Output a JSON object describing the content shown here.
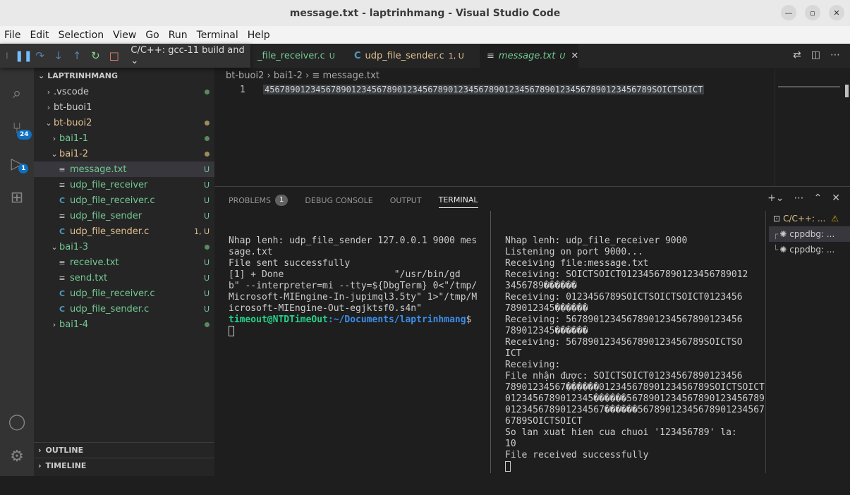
{
  "window": {
    "title": "message.txt - laptrinhmang - Visual Studio Code"
  },
  "menu": [
    "File",
    "Edit",
    "Selection",
    "View",
    "Go",
    "Run",
    "Terminal",
    "Help"
  ],
  "activity": {
    "scm_badge": "24",
    "debug_badge": "1"
  },
  "debug_toolbar": {
    "config_label": "C/C++: gcc-11 build and"
  },
  "tabs": [
    {
      "label": "_file_receiver.c",
      "status": "U"
    },
    {
      "label": "udp_file_sender.c",
      "status": "1, U"
    },
    {
      "label": "message.txt",
      "status": "U"
    }
  ],
  "explorer": {
    "root": "LAPTRINHMANG",
    "items": [
      {
        "label": ".vscode",
        "status": "dot"
      },
      {
        "label": "bt-buoi1",
        "status": ""
      },
      {
        "label": "bt-buoi2",
        "status": "dot"
      },
      {
        "label": "bai1-1",
        "status": "dot"
      },
      {
        "label": "bai1-2",
        "status": "dot"
      },
      {
        "label": "message.txt",
        "status": "U"
      },
      {
        "label": "udp_file_receiver",
        "status": "U"
      },
      {
        "label": "udp_file_receiver.c",
        "status": "U"
      },
      {
        "label": "udp_file_sender",
        "status": "U"
      },
      {
        "label": "udp_file_sender.c",
        "status": "1, U"
      },
      {
        "label": "bai1-3",
        "status": "dot"
      },
      {
        "label": "receive.txt",
        "status": "U"
      },
      {
        "label": "send.txt",
        "status": "U"
      },
      {
        "label": "udp_file_receiver.c",
        "status": "U"
      },
      {
        "label": "udp_file_sender.c",
        "status": "U"
      },
      {
        "label": "bai1-4",
        "status": "dot"
      }
    ],
    "outline": "OUTLINE",
    "timeline": "TIMELINE"
  },
  "editor": {
    "breadcrumb": [
      "bt-buoi2",
      "bai1-2",
      "message.txt"
    ],
    "line_number": "1",
    "line_text": "4567890123456789012345678901234567890123456789012345678901234567890123456789SOICTSOICT"
  },
  "panel": {
    "tabs": [
      "PROBLEMS",
      "DEBUG CONSOLE",
      "OUTPUT",
      "TERMINAL"
    ],
    "problems_count": "1",
    "left_terminal": [
      "Nhap lenh: udp_file_sender 127.0.0.1 9000 mes",
      "sage.txt",
      "File sent successfully",
      "[1] + Done                    \"/usr/bin/gd",
      "b\" --interpreter=mi --tty=${DbgTerm} 0<\"/tmp/",
      "Microsoft-MIEngine-In-jupimql3.5ty\" 1>\"/tmp/M",
      "icrosoft-MIEngine-Out-egjktsf0.s4n\""
    ],
    "prompt_user": "timeout@NTDTimeOut",
    "prompt_path": ":~/Documents/laptrinhmang",
    "prompt_end": "$",
    "right_terminal": [
      "Nhap lenh: udp_file_receiver 9000",
      "Listening on port 9000...",
      "Receiving file:message.txt",
      "Receiving: SOICTSOICT01234567890123456789012",
      "3456789������",
      "Receiving: 0123456789SOICTSOICTSOICT0123456",
      "789012345������",
      "Receiving: 56789012345678901234567890123456",
      "789012345������",
      "Receiving: 5678901234567890123456789SOICTSO",
      "ICT",
      "Receiving: ",
      "File nhận được: SOICTSOICT01234567890123456",
      "78901234567������01234567890123456789SOICTSOICT",
      "0123456789012345������5678901234567890123456789",
      "012345678901234567������56789012345678901234567",
      "6789SOICTSOICT",
      "So lan xuat hien cua chuoi '123456789' la:",
      "10",
      "File received successfully"
    ],
    "terminal_list": [
      "C/C++: ...",
      "cppdbg: ...",
      "cppdbg: ..."
    ]
  }
}
